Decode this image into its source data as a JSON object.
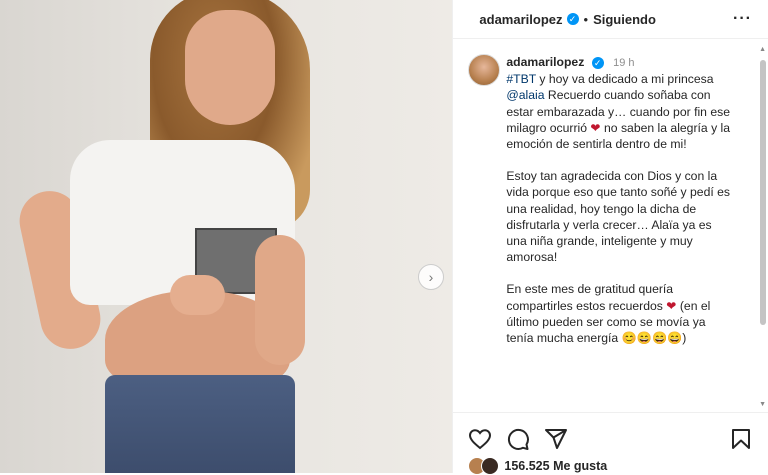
{
  "post": {
    "username": "adamarilopez",
    "follow_label": "Siguiendo",
    "dot": "•",
    "more_label": "···",
    "next_label": "›"
  },
  "caption": {
    "username": "adamarilopez",
    "time": "19 h",
    "p1_a": "#TBT y hoy va dedicado a mi princesa",
    "p1_mention": "@alaia",
    "p1_b": "Recuerdo cuando soñaba con estar embarazada y… cuando por fin ese milagro ocurrió",
    "p1_c": "no saben la alegría y la emoción de sentirla dentro de mi!",
    "p2": "Estoy tan agradecida con Dios y con la vida porque eso que tanto soñé y pedí es una realidad, hoy tengo la dicha de disfrutarla y verla crecer… Alaïa ya es una niña grande, inteligente y muy amorosa!",
    "p3_a": "En este mes de gratitud quería compartirles estos recuerdos",
    "p3_b": "(en el último pueden ser como se movía ya tenía mucha energía",
    "p3_c": ")",
    "heart": "❤",
    "emojis": "😊😄😄😄"
  },
  "likes": {
    "count_label": "156.525 Me gusta"
  },
  "colors": {
    "verified": "#0095f6",
    "heart": "#c0172f",
    "link": "#00376b"
  },
  "icons": [
    "heart-outline-icon",
    "comment-icon",
    "share-icon",
    "bookmark-icon",
    "verified-badge-icon",
    "more-options-icon",
    "chevron-right-icon"
  ]
}
